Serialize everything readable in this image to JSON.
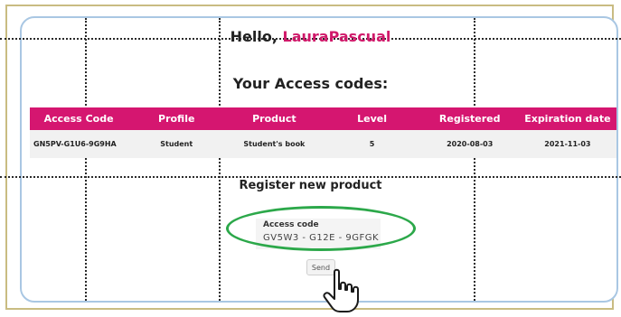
{
  "user": {
    "greeting": "Hello,",
    "name": "LauraPascual"
  },
  "access_codes": {
    "title": "Your Access codes:",
    "columns": [
      "Access Code",
      "Profile",
      "Product",
      "Level",
      "Registered",
      "Expiration date"
    ],
    "rows": [
      [
        "GN5PV-G1U6-9G9HA",
        "Student",
        "Student's book",
        "5",
        "2020-08-03",
        "2021-11-03"
      ]
    ]
  },
  "register": {
    "title": "Register new product",
    "field_label": "Access code",
    "field_value": "GV5W3 - G12E  - 9GFGK",
    "send_label": "Send"
  },
  "colors": {
    "accent": "#d51670",
    "highlight": "#2ca84a",
    "panel_border": "#a9c7e3"
  },
  "icons": [
    "pointer-hand-icon"
  ]
}
